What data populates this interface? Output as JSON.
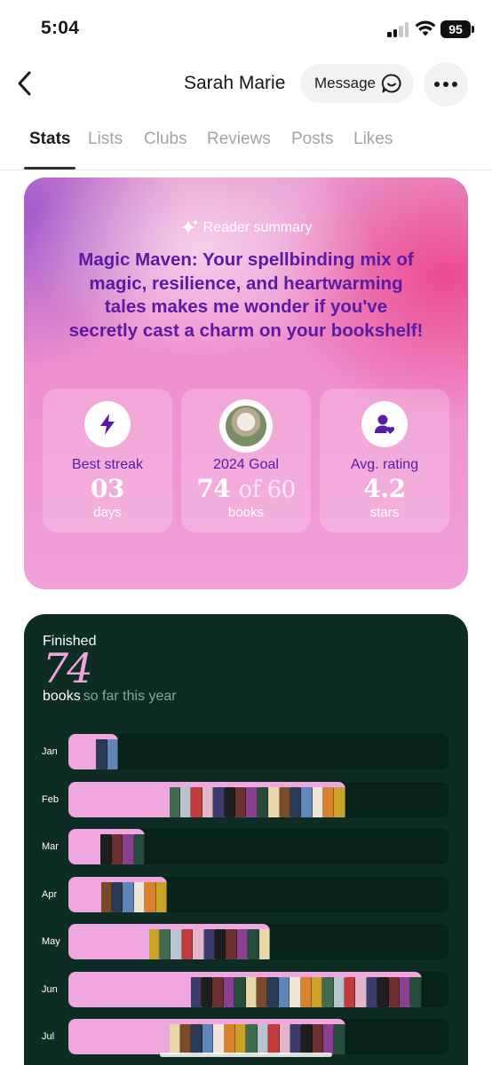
{
  "status_bar": {
    "time": "5:04",
    "battery": "95",
    "signal_bars_on": 2
  },
  "header": {
    "name": "Sarah Marie",
    "message_label": "Message"
  },
  "tabs": [
    {
      "label": "Stats",
      "active": true
    },
    {
      "label": "Lists",
      "active": false
    },
    {
      "label": "Clubs",
      "active": false
    },
    {
      "label": "Reviews",
      "active": false
    },
    {
      "label": "Posts",
      "active": false
    },
    {
      "label": "Likes",
      "active": false
    }
  ],
  "summary": {
    "label": "Reader summary",
    "text": "Magic Maven: Your spellbinding mix of magic, resilience, and heartwarming tales makes me wonder if you've secretly cast a charm on your bookshelf!",
    "stats": [
      {
        "label": "Best streak",
        "value": "03",
        "unit": "days",
        "icon": "lightning-icon"
      },
      {
        "label": "2024 Goal",
        "value": "74",
        "value_suffix": "of 60",
        "unit": "books",
        "icon": "goal-avatar"
      },
      {
        "label": "Avg. rating",
        "value": "4.2",
        "unit": "stars",
        "icon": "user-heart-icon"
      }
    ]
  },
  "finished": {
    "label": "Finished",
    "count": "74",
    "unit": "books",
    "subtitle": "so far this year",
    "months": [
      {
        "label": "Jan",
        "fraction": 0.13,
        "books": 2
      },
      {
        "label": "Feb",
        "fraction": 0.73,
        "books": 16
      },
      {
        "label": "Mar",
        "fraction": 0.2,
        "books": 4
      },
      {
        "label": "Apr",
        "fraction": 0.26,
        "books": 6
      },
      {
        "label": "May",
        "fraction": 0.53,
        "books": 11
      },
      {
        "label": "Jun",
        "fraction": 0.93,
        "books": 21
      },
      {
        "label": "Jul",
        "fraction": 0.73,
        "books": 16
      }
    ],
    "cover_colors": [
      "#2b3a55",
      "#c23b3b",
      "#e8d7a8",
      "#3f6b4f",
      "#8a3f8f",
      "#d9822b",
      "#1f1f1f",
      "#5e86b8",
      "#e3b5c8",
      "#7a4a2a",
      "#b8c4cf",
      "#264d3b",
      "#c9a227",
      "#6d2f2f",
      "#f0e6d8",
      "#3b3b6d"
    ]
  }
}
